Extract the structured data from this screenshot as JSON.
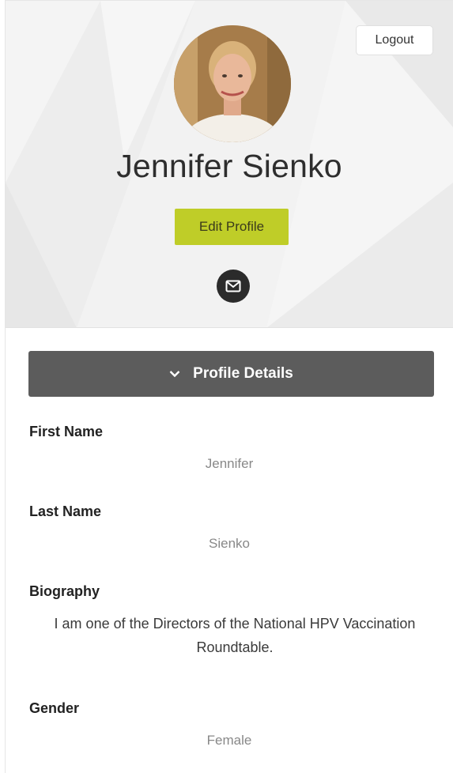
{
  "header": {
    "logout_label": "Logout",
    "user_name": "Jennifer Sienko",
    "edit_profile_label": "Edit Profile"
  },
  "details": {
    "section_title": "Profile Details",
    "fields": [
      {
        "label": "First Name",
        "value": "Jennifer"
      },
      {
        "label": "Last Name",
        "value": "Sienko"
      },
      {
        "label": "Biography",
        "value": "I am one of the Directors of the National HPV Vaccination Roundtable."
      },
      {
        "label": "Gender",
        "value": "Female"
      }
    ]
  },
  "icons": {
    "mail": "envelope-icon",
    "chevron": "chevron-down-icon"
  },
  "colors": {
    "edit_button": "#bfcd28",
    "details_bar": "#5c5c5c",
    "mail_button": "#2b2b2b",
    "header_bg": "#f0f0f0"
  }
}
